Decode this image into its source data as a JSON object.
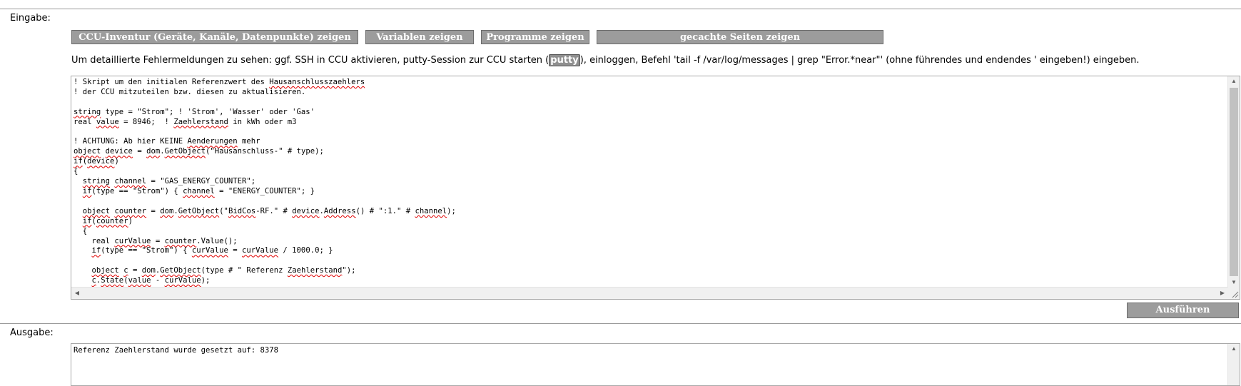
{
  "input": {
    "label": "Eingabe:",
    "buttons": [
      "CCU-Inventur (Geräte, Kanäle, Datenpunkte) zeigen",
      "Variablen zeigen",
      "Programme zeigen",
      "gecachte Seiten zeigen"
    ],
    "hint": {
      "before": "Um detaillierte Fehlermeldungen zu sehen: ggf. SSH in CCU aktivieren, putty-Session zur CCU starten (",
      "link": "putty",
      "after": "), einloggen, Befehl 'tail -f /var/log/messages | grep \"Error.*near\"' (ohne führendes und endendes ' eingeben!) eingeben."
    },
    "code_lines": [
      "! Skript um den initialen Referenzwert des Hausanschlusszaehlers",
      "! der CCU mitzuteilen bzw. diesen zu aktualisieren.",
      "",
      "string type = \"Strom\"; ! 'Strom', 'Wasser' oder 'Gas'",
      "real value = 8946;  ! Zaehlerstand in kWh oder m3",
      "",
      "! ACHTUNG: Ab hier KEINE Aenderungen mehr",
      "object device = dom.GetObject(\"Hausanschluss-\" # type);",
      "if(device)",
      "{",
      "  string channel = \"GAS_ENERGY_COUNTER\";",
      "  if(type == \"Strom\") { channel = \"ENERGY_COUNTER\"; }",
      "",
      "  object counter = dom.GetObject(\"BidCos-RF.\" # device.Address() # \":1.\" # channel);",
      "  if(counter)",
      "  {",
      "    real curValue = counter.Value();",
      "    if(type == \"Strom\") { curValue = curValue / 1000.0; }",
      "",
      "    object c = dom.GetObject(type # \" Referenz Zaehlerstand\");",
      "    c.State(value - curValue);"
    ],
    "spellcheck_words": [
      "Hausanschlusszaehlers",
      "string",
      "value",
      "Zaehlerstand",
      "Aenderungen",
      "object",
      "device",
      "dom",
      "GetObject",
      "if",
      "channel",
      "counter",
      "BidCos",
      "Address",
      "curValue",
      "c",
      "State"
    ],
    "run_button": "Ausführen"
  },
  "output": {
    "label": "Ausgabe:",
    "text": "Referenz Zaehlerstand wurde gesetzt auf: 8378"
  }
}
